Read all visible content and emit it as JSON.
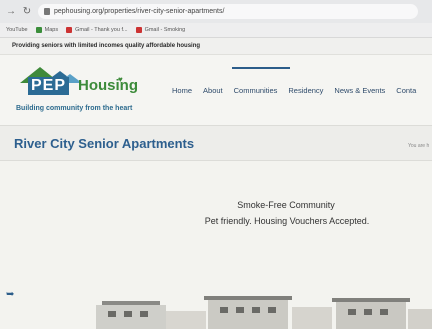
{
  "browser": {
    "back_icon": "arrow-left-icon",
    "reload_icon": "reload-icon",
    "url": "pephousing.org/properties/river-city-senior-apartments/"
  },
  "bookmarks": [
    {
      "label": "YouTube",
      "icon": "youtube-icon",
      "color": "#d33"
    },
    {
      "label": "Maps",
      "icon": "maps-icon",
      "color": "#3b8e3b"
    },
    {
      "label": "Gmail - Thank you f...",
      "icon": "gmail-icon",
      "color": "#c33"
    },
    {
      "label": "Gmail - Smoking",
      "icon": "gmail-icon",
      "color": "#c33"
    }
  ],
  "banner": {
    "text": "Providing seniors with limited incomes quality affordable housing"
  },
  "logo": {
    "pep": "PEP",
    "housing": "Housing",
    "tagline": "Building community from the heart"
  },
  "nav": {
    "items": [
      "Home",
      "About",
      "Communities",
      "Residency",
      "News & Events",
      "Conta"
    ],
    "active": "Communities"
  },
  "page": {
    "title": "River City Senior Apartments",
    "breadcrumb": "You are h"
  },
  "content": {
    "line1": "Smoke-Free Community",
    "line2": "Pet friendly. Housing Vouchers Accepted."
  },
  "colors": {
    "brand_blue": "#2d5f8e",
    "brand_green": "#3c8b3a"
  }
}
